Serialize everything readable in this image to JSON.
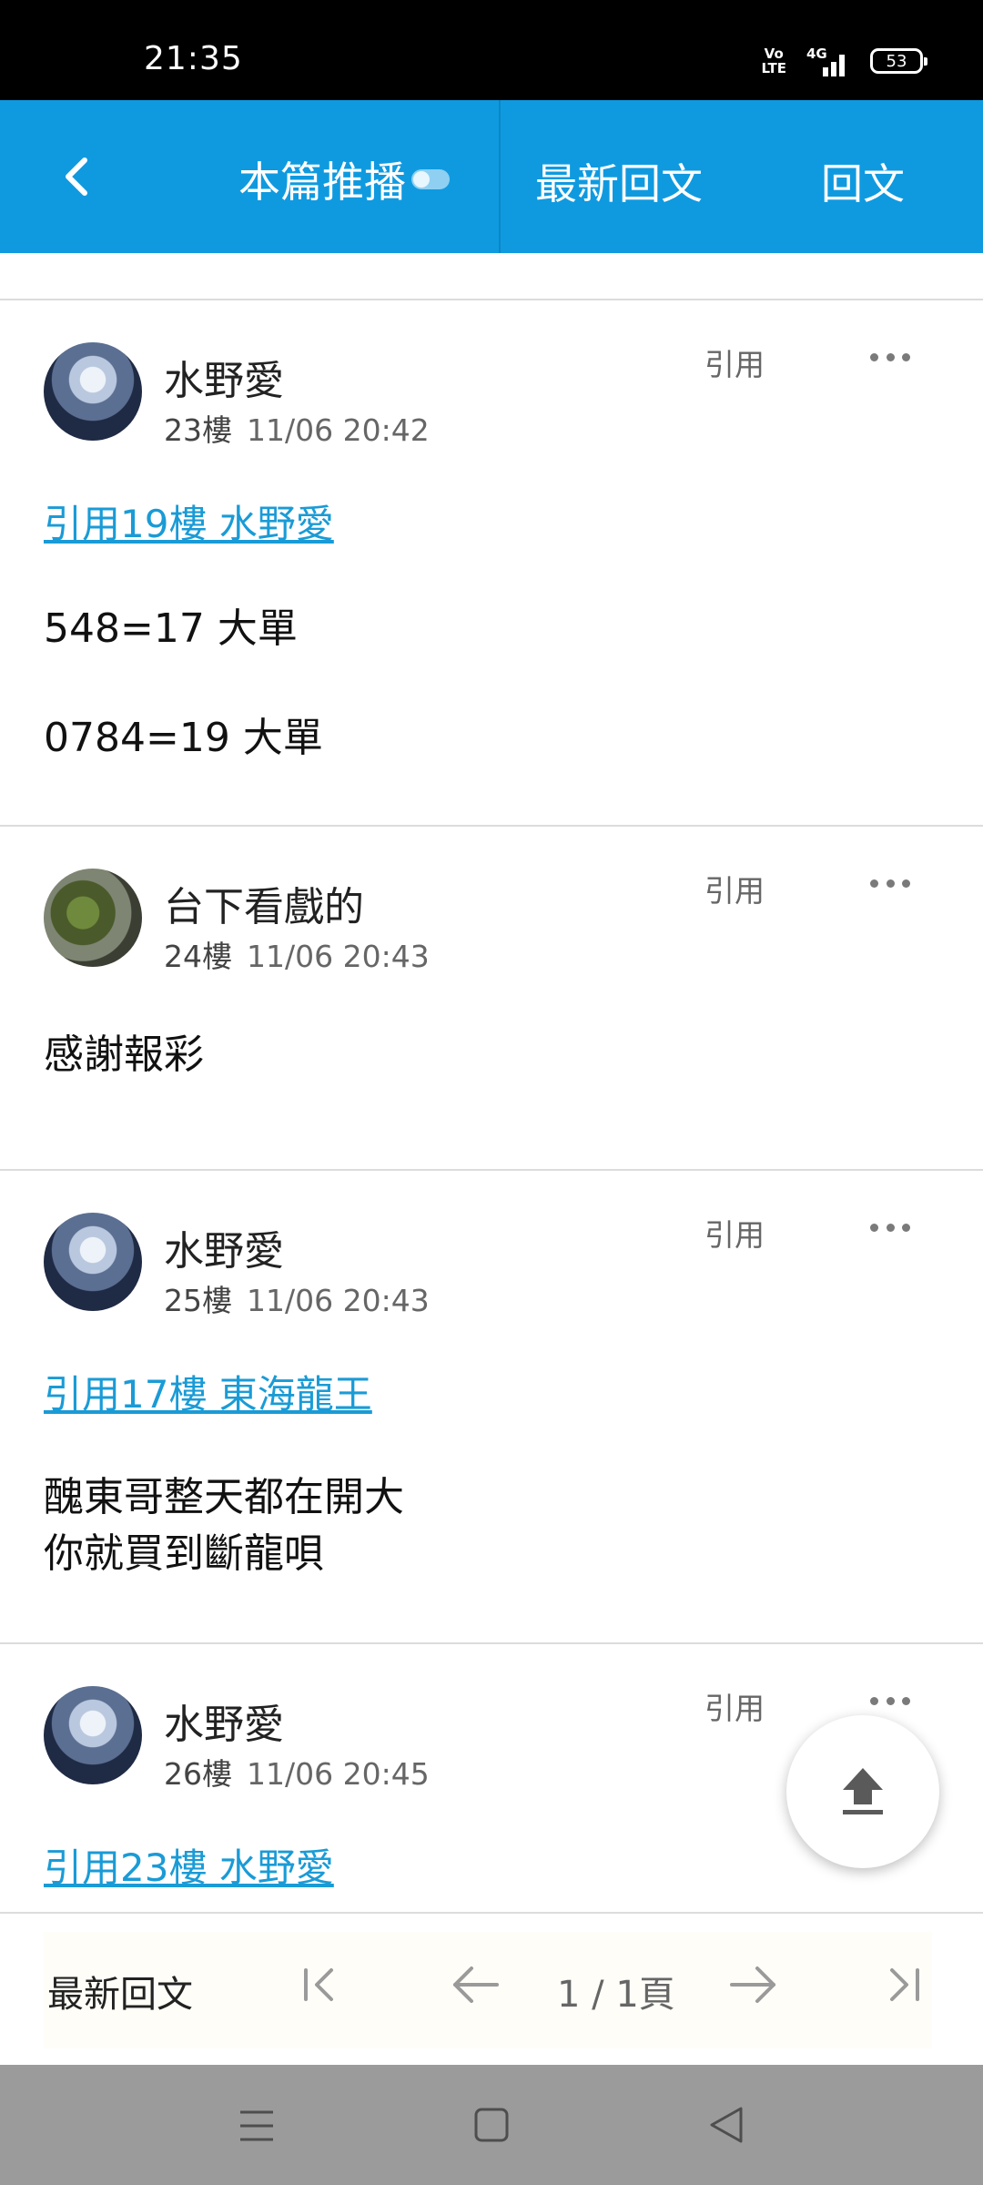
{
  "status_bar": {
    "time": "21:35",
    "volte_top": "Vo",
    "volte_bottom": "LTE",
    "network": "4G",
    "battery": "53"
  },
  "header": {
    "back_icon": "chevron-left-icon",
    "tab_push": "本篇推播",
    "tab_latest": "最新回文",
    "tab_reply": "回文",
    "color": "#0f9ae0"
  },
  "posts": [
    {
      "author": "水野愛",
      "floor": "23樓",
      "time": "11/06 20:42",
      "quote_label": "引用",
      "quote_link": "引用19樓 水野愛",
      "lines": [
        "548=17 大單",
        "0784=19 大單"
      ]
    },
    {
      "author": "台下看戲的",
      "floor": "24樓",
      "time": "11/06 20:43",
      "quote_label": "引用",
      "lines": [
        "感謝報彩"
      ]
    },
    {
      "author": "水野愛",
      "floor": "25樓",
      "time": "11/06 20:43",
      "quote_label": "引用",
      "quote_link": "引用17樓 東海龍王",
      "lines": [
        "醜東哥整天都在開大",
        "你就買到斷龍唄"
      ]
    },
    {
      "author": "水野愛",
      "floor": "26樓",
      "time": "11/06 20:45",
      "quote_label": "引用",
      "quote_link": "引用23樓 水野愛"
    }
  ],
  "pager": {
    "label": "最新回文",
    "page": "1 / 1頁"
  },
  "colors": {
    "link": "#1a9bd6",
    "accent": "#0f9ae0"
  }
}
